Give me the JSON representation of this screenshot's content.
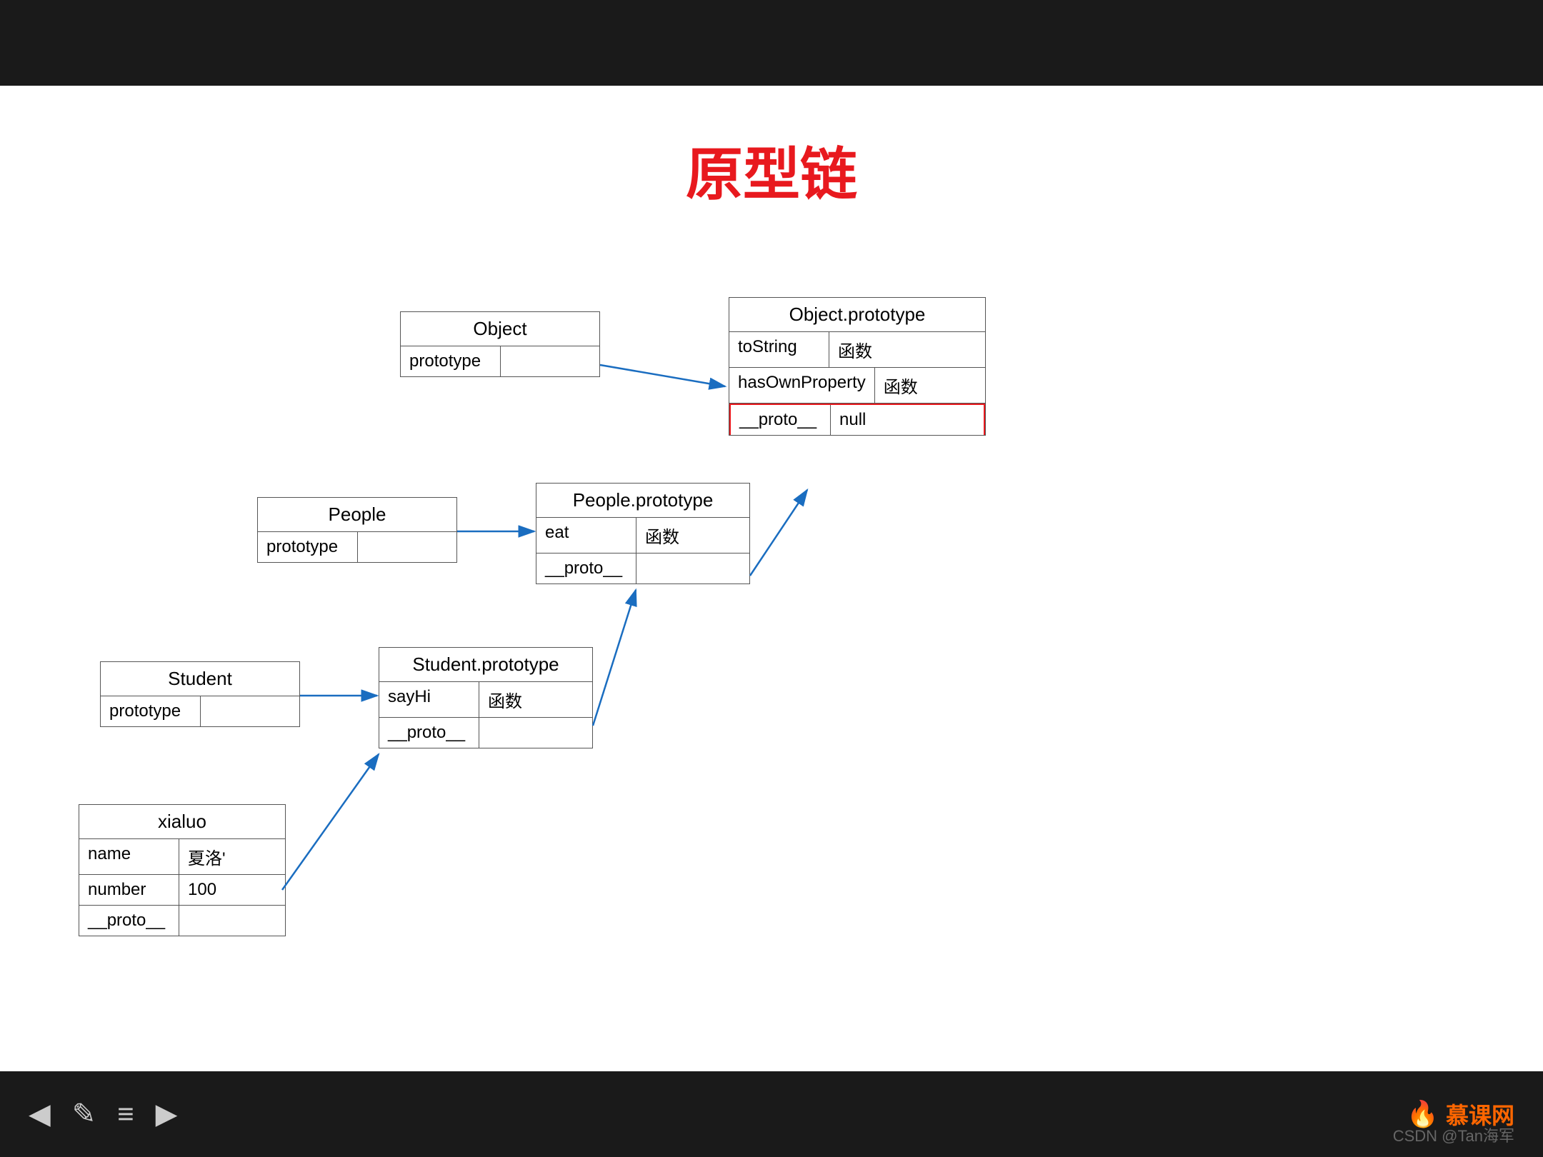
{
  "title": "原型链",
  "boxes": {
    "object": {
      "title": "Object",
      "rows": [
        {
          "left": "prototype",
          "right": ""
        }
      ]
    },
    "objectPrototype": {
      "title": "Object.prototype",
      "rows": [
        {
          "left": "toString",
          "right": "函数"
        },
        {
          "left": "hasOwnProperty",
          "right": "函数"
        },
        {
          "left": "__proto__",
          "right": "null",
          "highlight": true
        }
      ]
    },
    "people": {
      "title": "People",
      "rows": [
        {
          "left": "prototype",
          "right": ""
        }
      ]
    },
    "peoplePrototype": {
      "title": "People.prototype",
      "rows": [
        {
          "left": "eat",
          "right": "函数"
        },
        {
          "left": "__proto__",
          "right": ""
        }
      ]
    },
    "student": {
      "title": "Student",
      "rows": [
        {
          "left": "prototype",
          "right": ""
        }
      ]
    },
    "studentPrototype": {
      "title": "Student.prototype",
      "rows": [
        {
          "left": "sayHi",
          "right": "函数"
        },
        {
          "left": "__proto__",
          "right": ""
        }
      ]
    },
    "xialuo": {
      "title": "xialuo",
      "rows": [
        {
          "left": "name",
          "right": "夏洛'"
        },
        {
          "left": "number",
          "right": "100"
        },
        {
          "left": "__proto__",
          "right": ""
        }
      ]
    }
  },
  "nav": {
    "back": "◀",
    "edit": "✎",
    "menu": "≡",
    "forward": "▶"
  },
  "brand": {
    "icon": "🔥",
    "text": "慕课网"
  },
  "watermark": "CSDN @Tan海军"
}
